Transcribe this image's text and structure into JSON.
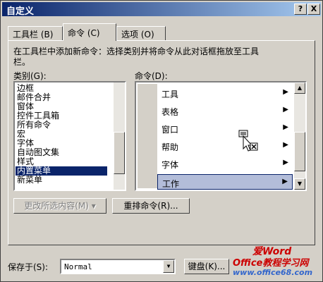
{
  "window": {
    "title": "自定义",
    "help_glyph": "?",
    "close_glyph": "X"
  },
  "tabs": [
    {
      "label": "工具栏 (B)"
    },
    {
      "label": "命令 (C)"
    },
    {
      "label": "选项 (O)"
    }
  ],
  "panel": {
    "instructions": "在工具栏中添加新命令：选择类别并将命令从此对话框拖放至工具栏。",
    "instructions_line1": "在工具栏中添加新命令：选择类别并将命令从此对话框拖放至工具",
    "instructions_line2": "栏。",
    "categories_label": "类别(G):",
    "commands_label": "命令(D):",
    "categories": [
      "边框",
      "邮件合并",
      "窗体",
      "控件工具箱",
      "所有命令",
      "宏",
      "字体",
      "自动图文集",
      "样式",
      "内置菜单",
      "新菜单"
    ],
    "selected_category": "内置菜单",
    "commands": [
      {
        "label": "工具",
        "arrow": "▶"
      },
      {
        "label": "表格",
        "arrow": "▶"
      },
      {
        "label": "窗口",
        "arrow": "▶"
      },
      {
        "label": "帮助",
        "arrow": "▶"
      },
      {
        "label": "字体",
        "arrow": "▶"
      },
      {
        "label": "工作",
        "arrow": "▶"
      }
    ],
    "selected_command": "工作",
    "modify_selection_label": "更改所选内容(M) ▾",
    "rearrange_label": "重排命令(R)..."
  },
  "bottom": {
    "save_in_label": "保存于(S):",
    "save_in_value": "Normal",
    "keyboard_label": "键盘(K)..."
  },
  "watermark": {
    "line1": "爱Word",
    "line2": "Office教程学习网",
    "url": "www.office68.com"
  },
  "colors": {
    "titlebar_start": "#0a246a",
    "titlebar_end": "#a6caf0",
    "selection": "#0a246a",
    "command_highlight": "#b3bdd9",
    "watermark_red": "#cc0000"
  }
}
